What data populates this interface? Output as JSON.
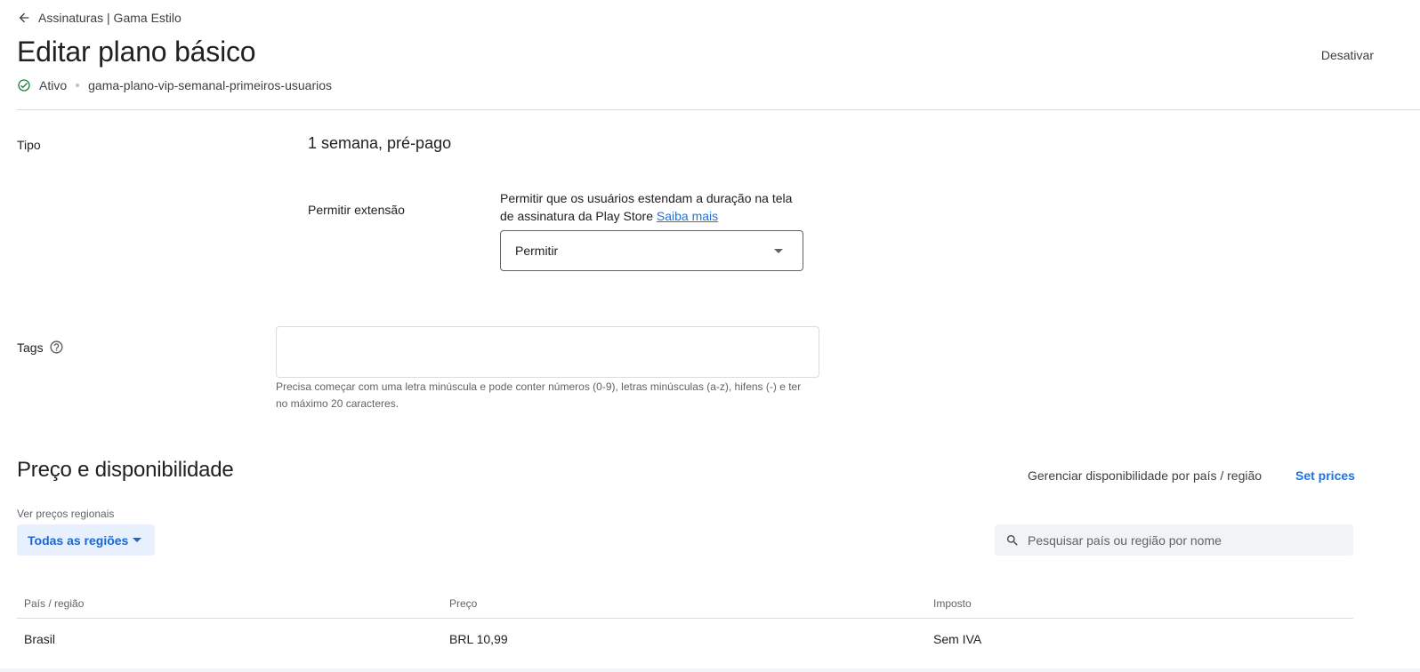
{
  "breadcrumb": {
    "label": "Assinaturas | Gama Estilo"
  },
  "header": {
    "title": "Editar plano básico",
    "deactivate_label": "Desativar",
    "status": "Ativo",
    "plan_id": "gama-plano-vip-semanal-primeiros-usuarios"
  },
  "type_section": {
    "label": "Tipo",
    "value": "1 semana, pré-pago",
    "extension": {
      "label": "Permitir extensão",
      "description": "Permitir que os usuários estendam a duração na tela de assinatura da Play Store",
      "learn_more": "Saiba mais",
      "selected": "Permitir"
    }
  },
  "tags": {
    "label": "Tags",
    "value": "",
    "hint": "Precisa começar com uma letra minúscula e pode conter números (0-9), letras minúsculas (a-z), hifens (-) e ter no máximo 20 caracteres."
  },
  "pricing": {
    "title": "Preço e disponibilidade",
    "manage_label": "Gerenciar disponibilidade por país / região",
    "set_prices_label": "Set prices",
    "regional_label": "Ver preços regionais",
    "region_filter": "Todas as regiões",
    "search_placeholder": "Pesquisar país ou região por nome",
    "columns": [
      "País / região",
      "Preço",
      "Imposto"
    ],
    "rows": [
      {
        "country": "Brasil",
        "price": "BRL 10,99",
        "tax": "Sem IVA"
      }
    ]
  },
  "colors": {
    "accent": "#1a73e8",
    "success": "#188038",
    "chip_bg": "#e8f0fe"
  },
  "icons": [
    "arrow-back-icon",
    "check-circle-icon",
    "help-icon",
    "dropdown-caret-icon",
    "search-icon"
  ]
}
